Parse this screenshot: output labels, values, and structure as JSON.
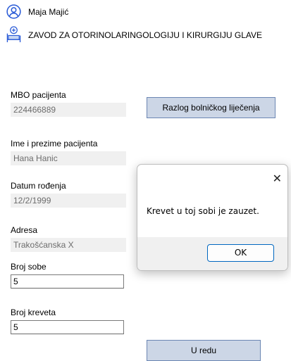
{
  "header": {
    "user_name": "Maja Majić",
    "department": "ZAVOD ZA OTORINOLARINGOLOGIJU I KIRURGIJU GLAVE"
  },
  "form": {
    "mbo_label": "MBO pacijenta",
    "mbo_value": "224466889",
    "name_label": "Ime i prezime pacijenta",
    "name_value": "Hana Hanic",
    "dob_label": "Datum rođenja",
    "dob_value": "12/2/1999",
    "address_label": "Adresa",
    "address_value": "Trakošćanska X",
    "room_label": "Broj sobe",
    "room_value": "5",
    "bed_label": "Broj kreveta",
    "bed_value": "5",
    "reason_button": "Razlog bolničkog liječenja",
    "ok_button": "U redu"
  },
  "dialog": {
    "close_glyph": "✕",
    "message": "Krevet u toj sobi je zauzet.",
    "ok_label": "OK"
  },
  "icons": {
    "user": "user-icon",
    "hospital": "hospital-bed-icon"
  },
  "colors": {
    "button_bg": "#ccd6e6",
    "button_border": "#6b86b3",
    "icon_blue": "#2a5bd7",
    "dialog_ok_border": "#0067c0"
  }
}
